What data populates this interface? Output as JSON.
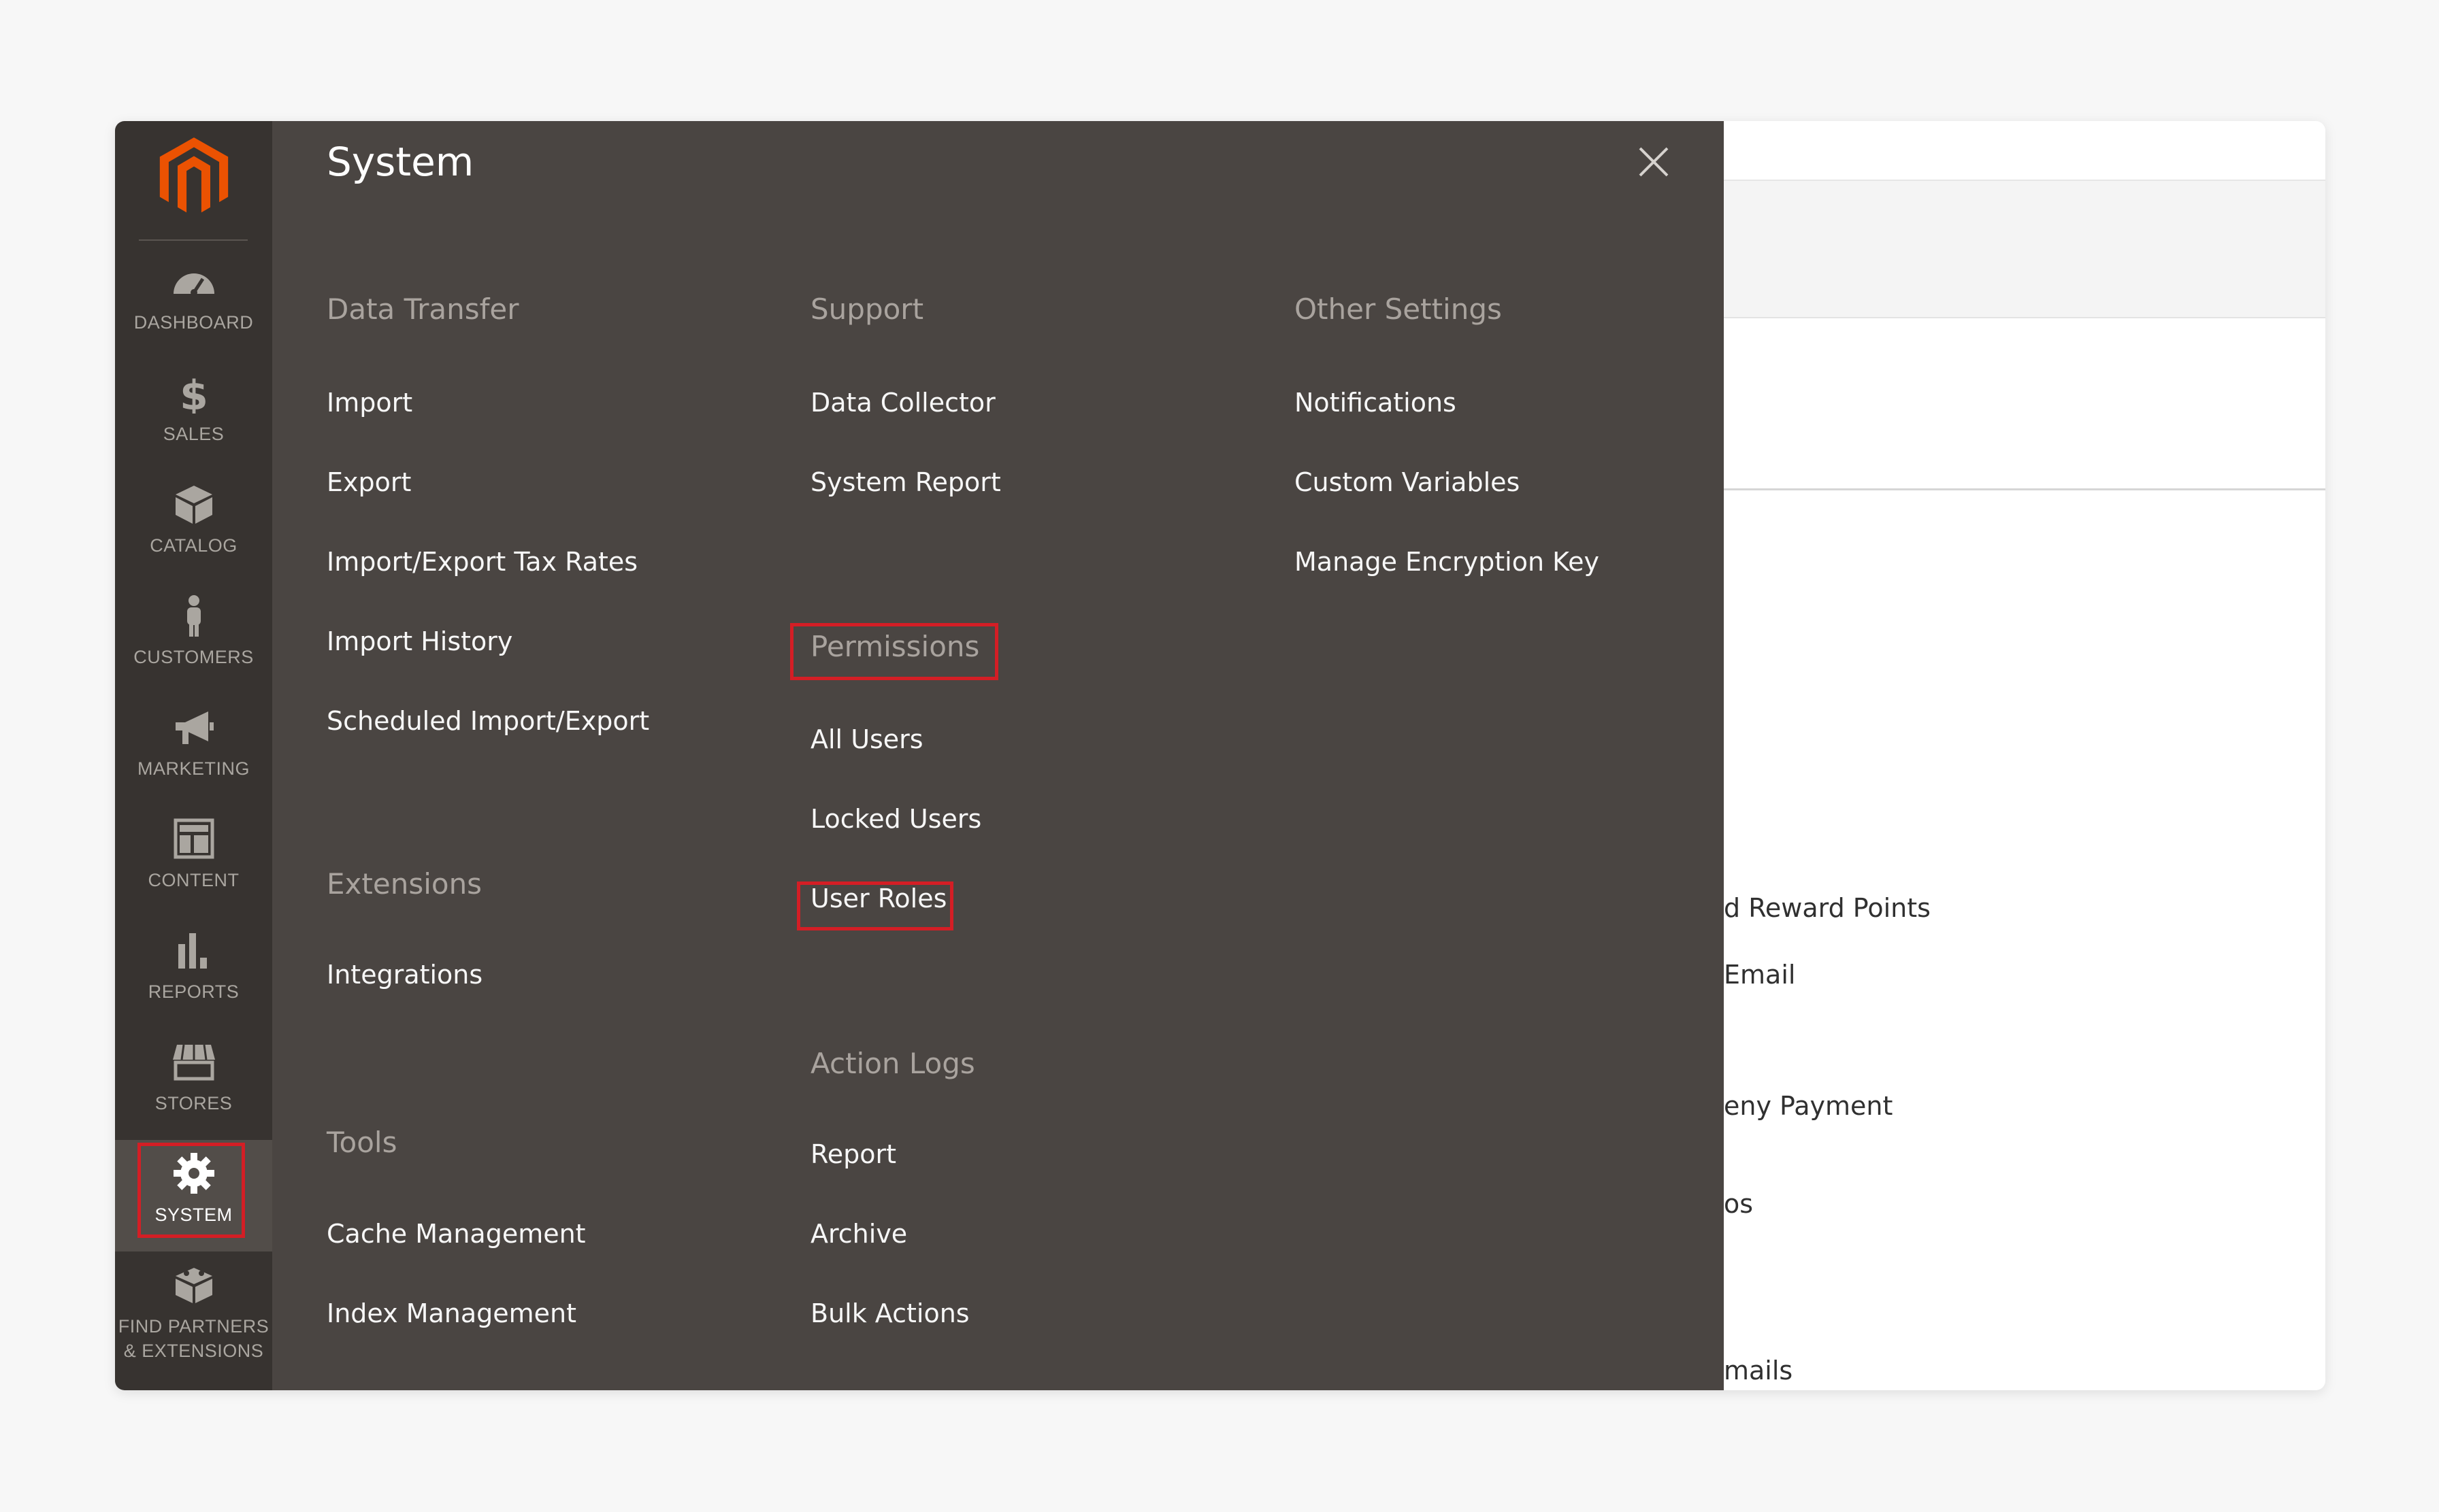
{
  "sidebar": {
    "logo": "magento-logo-icon",
    "items": [
      {
        "label": "DASHBOARD",
        "icon": "speedometer-icon"
      },
      {
        "label": "SALES",
        "icon": "dollar-icon"
      },
      {
        "label": "CATALOG",
        "icon": "box-icon"
      },
      {
        "label": "CUSTOMERS",
        "icon": "person-icon"
      },
      {
        "label": "MARKETING",
        "icon": "megaphone-icon"
      },
      {
        "label": "CONTENT",
        "icon": "layout-icon"
      },
      {
        "label": "REPORTS",
        "icon": "bar-chart-icon"
      },
      {
        "label": "STORES",
        "icon": "storefront-icon"
      },
      {
        "label": "SYSTEM",
        "icon": "gear-icon",
        "active": true
      },
      {
        "label_line1": "FIND PARTNERS",
        "label_line2": "& EXTENSIONS",
        "icon": "blocks-icon"
      }
    ]
  },
  "panel": {
    "title": "System",
    "close_icon": "close-icon",
    "columns": [
      {
        "groups": [
          {
            "title": "Data Transfer",
            "items": [
              "Import",
              "Export",
              "Import/Export Tax Rates",
              "Import History",
              "Scheduled Import/Export"
            ]
          },
          {
            "title": "Extensions",
            "items": [
              "Integrations"
            ]
          },
          {
            "title": "Tools",
            "items": [
              "Cache Management",
              "Index Management"
            ]
          }
        ]
      },
      {
        "groups": [
          {
            "title": "Support",
            "items": [
              "Data Collector",
              "System Report"
            ]
          },
          {
            "title": "Permissions",
            "items": [
              "All Users",
              "Locked Users",
              "User Roles"
            ]
          },
          {
            "title": "Action Logs",
            "items": [
              "Report",
              "Archive",
              "Bulk Actions"
            ]
          }
        ]
      },
      {
        "groups": [
          {
            "title": "Other Settings",
            "items": [
              "Notifications",
              "Custom Variables",
              "Manage Encryption Key"
            ]
          }
        ]
      }
    ]
  },
  "background": {
    "fragments": [
      "d Reward Points",
      "Email",
      "eny Payment",
      "os",
      "mails"
    ]
  },
  "colors": {
    "sidebar_bg": "#373330",
    "panel_bg": "#4a4542",
    "highlight": "#d41e25",
    "logo": "#eb5202"
  }
}
